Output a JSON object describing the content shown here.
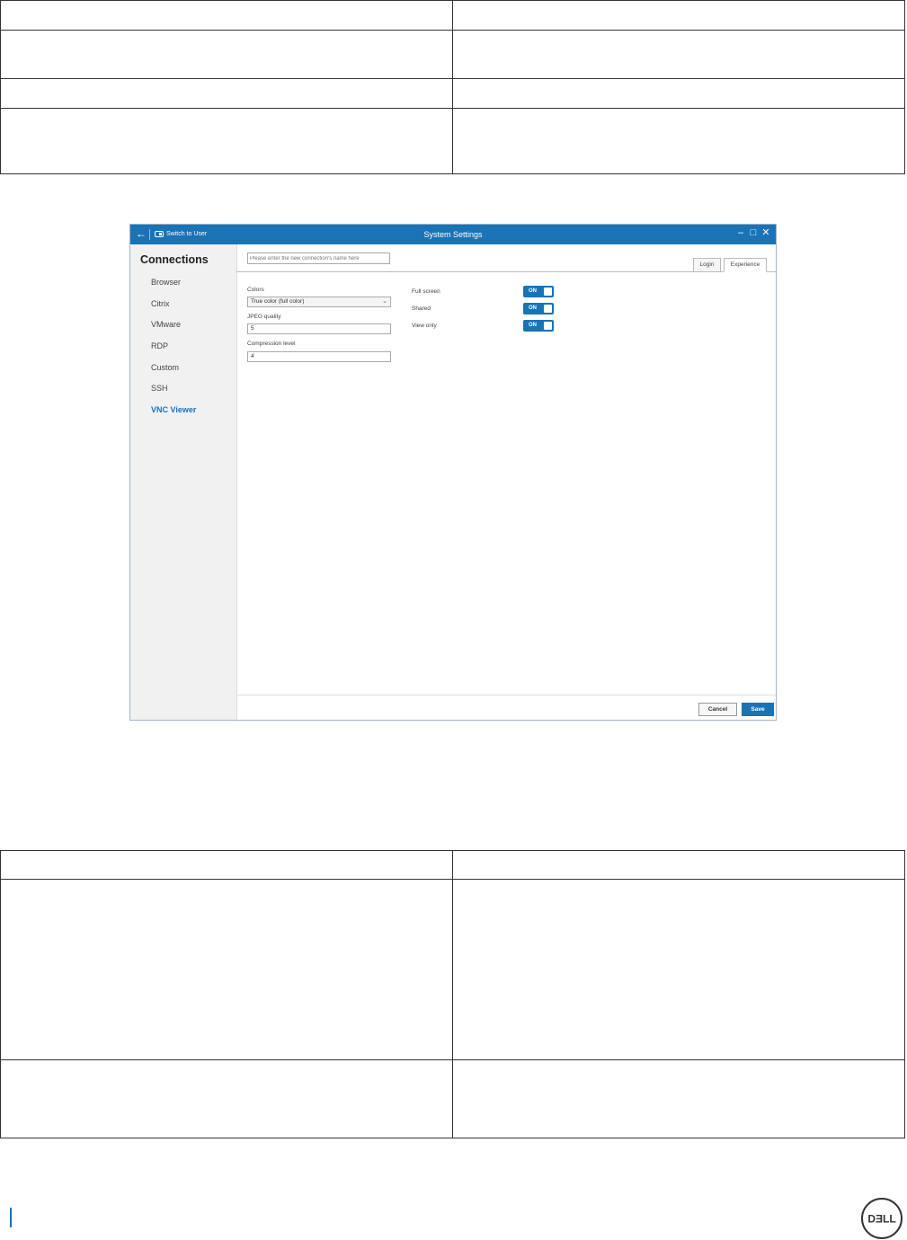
{
  "window": {
    "title": "System Settings",
    "switch_label": "Switch to User",
    "back_icon": "arrow-left-icon",
    "min_icon": "minimize-icon",
    "max_icon": "maximize-icon",
    "close_icon": "close-icon"
  },
  "sidebar": {
    "heading": "Connections",
    "items": [
      {
        "label": "Browser"
      },
      {
        "label": "Citrix"
      },
      {
        "label": "VMware"
      },
      {
        "label": "RDP"
      },
      {
        "label": "Custom"
      },
      {
        "label": "SSH"
      },
      {
        "label": "VNC Viewer",
        "active": true
      }
    ]
  },
  "connection_name": {
    "placeholder": "Please enter the new connection's name here"
  },
  "tabs": [
    {
      "label": "Login"
    },
    {
      "label": "Experience",
      "active": true
    }
  ],
  "form": {
    "colors": {
      "label": "Colors",
      "value": "True color (full color)"
    },
    "jpeg_quality": {
      "label": "JPEG quality",
      "value": "5"
    },
    "compression": {
      "label": "Compression level",
      "value": "4"
    },
    "toggles": [
      {
        "label": "Full screen",
        "state": "ON"
      },
      {
        "label": "Shared",
        "state": "ON"
      },
      {
        "label": "View only",
        "state": "ON"
      }
    ]
  },
  "footer": {
    "cancel": "Cancel",
    "save": "Save"
  },
  "colors": {
    "accent": "#1a73b5"
  }
}
